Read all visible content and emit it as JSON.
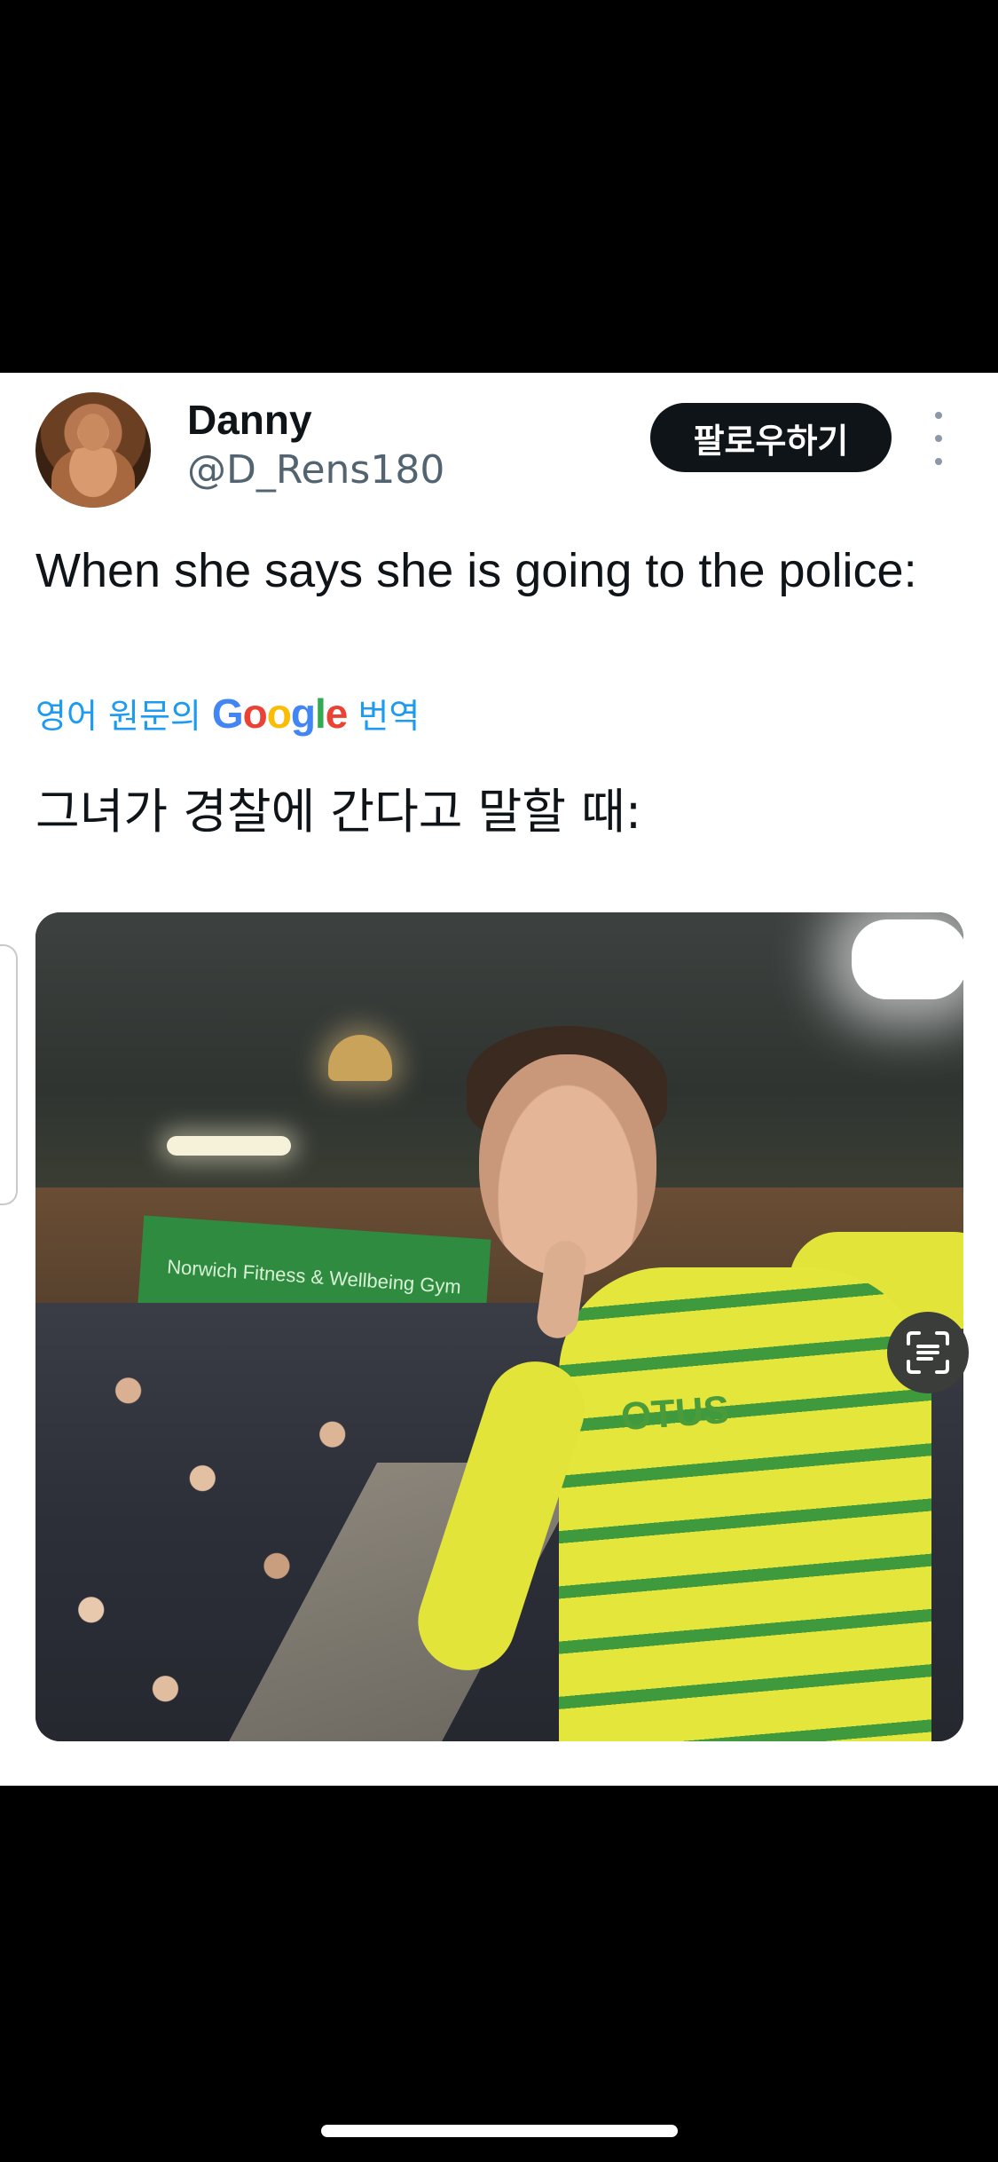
{
  "author": {
    "name": "Danny",
    "handle": "@D_Rens180"
  },
  "actions": {
    "follow_label": "팔로우하기",
    "more_icon": "more-vertical-icon"
  },
  "tweet": {
    "text": "When she says she is going to the police:",
    "translation_prefix": "영어 원문의",
    "translation_brand": "Google",
    "translation_suffix": "번역",
    "translated_text": "그녀가 경찰에 간다고 말할 때:"
  },
  "media": {
    "sign_text": "Norwich Fitness & Wellbeing Gym",
    "shirt_text": "OTUS",
    "scan_icon": "scan-text-icon"
  },
  "colors": {
    "link": "#1d9bf0",
    "text": "#0f1419",
    "muted": "#536471",
    "button": "#0f1419"
  }
}
